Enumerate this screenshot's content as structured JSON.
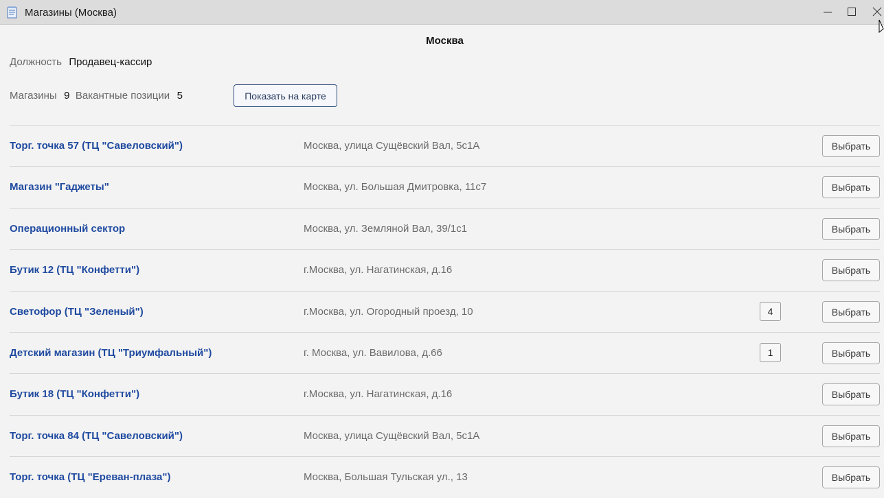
{
  "window": {
    "title": "Магазины (Москва)"
  },
  "header": {
    "city": "Москва",
    "position_label": "Должность",
    "position_value": "Продавец-кассир",
    "stores_label": "Магазины",
    "stores_count": "9",
    "vacancies_label": "Вакантные позиции",
    "vacancies_count": "5",
    "map_button_label": "Показать на карте"
  },
  "stores": [
    {
      "name": "Торг. точка 57 (ТЦ \"Савеловский\")",
      "address": "Москва, улица Сущёвский Вал, 5с1А",
      "vacancies": "",
      "select_label": "Выбрать"
    },
    {
      "name": "Магазин \"Гаджеты\"",
      "address": "Москва, ул. Большая Дмитровка, 11с7",
      "vacancies": "",
      "select_label": "Выбрать"
    },
    {
      "name": "Операционный сектор",
      "address": "Москва, ул. Земляной Вал, 39/1с1",
      "vacancies": "",
      "select_label": "Выбрать"
    },
    {
      "name": "Бутик 12 (ТЦ \"Конфетти\")",
      "address": "г.Москва, ул. Нагатинская, д.16",
      "vacancies": "",
      "select_label": "Выбрать"
    },
    {
      "name": "Светофор (ТЦ \"Зеленый\")",
      "address": "г.Москва, ул. Огородный проезд, 10",
      "vacancies": "4",
      "select_label": "Выбрать"
    },
    {
      "name": "Детский магазин (ТЦ \"Триумфальный\")",
      "address": "г. Москва, ул. Вавилова, д.66",
      "vacancies": "1",
      "select_label": "Выбрать"
    },
    {
      "name": "Бутик 18 (ТЦ \"Конфетти\")",
      "address": "г.Москва, ул. Нагатинская, д.16",
      "vacancies": "",
      "select_label": "Выбрать"
    },
    {
      "name": "Торг. точка 84 (ТЦ \"Савеловский\")",
      "address": "Москва, улица Сущёвский Вал, 5с1А",
      "vacancies": "",
      "select_label": "Выбрать"
    },
    {
      "name": "Торг. точка (ТЦ \"Ереван-плаза\")",
      "address": "Москва, Большая Тульская ул., 13",
      "vacancies": "",
      "select_label": "Выбрать"
    }
  ],
  "colors": {
    "link": "#1f4aa0",
    "accent_border": "#2c4a78"
  },
  "icons": {
    "app": "notepad-icon",
    "minimize": "minimize-icon",
    "maximize": "maximize-icon",
    "close": "close-icon"
  }
}
